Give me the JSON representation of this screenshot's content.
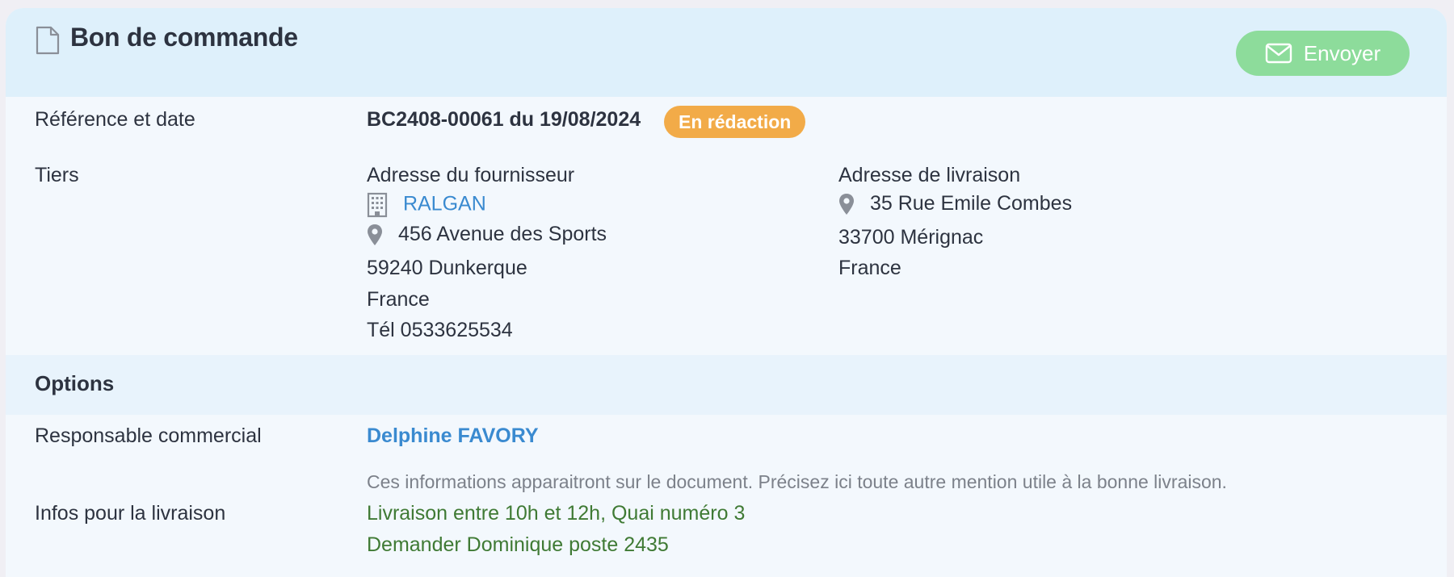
{
  "header": {
    "title": "Bon de commande",
    "send_label": "Envoyer"
  },
  "reference": {
    "label": "Référence et date",
    "value": "BC2408-00061 du 19/08/2024",
    "status": "En rédaction"
  },
  "tiers": {
    "label": "Tiers",
    "supplier": {
      "heading": "Adresse du fournisseur",
      "name": "RALGAN",
      "street": "456 Avenue des Sports",
      "city": "59240 Dunkerque",
      "country": "France",
      "phone": "Tél 0533625534"
    },
    "delivery": {
      "heading": "Adresse de livraison",
      "street": "35 Rue Emile Combes",
      "city": "33700 Mérignac",
      "country": "France"
    }
  },
  "options": {
    "title": "Options",
    "sales_label": "Responsable commercial",
    "sales_value": "Delphine FAVORY",
    "delivery_info_label": "Infos pour la livraison",
    "delivery_info_hint": "Ces informations apparaitront sur le document. Précisez ici toute autre mention utile à la bonne livraison.",
    "delivery_info_lines": [
      "Livraison entre 10h et 12h, Quai numéro 3",
      "Demander Dominique poste 2435"
    ]
  },
  "colors": {
    "header_bg": "#def0fb",
    "send_button": "#8ddc9b",
    "status_badge": "#f2ab48",
    "link": "#3a8ad0",
    "delivery_text": "#3f7a34"
  },
  "icons": [
    "document-icon",
    "envelope-icon",
    "building-icon",
    "map-pin-icon"
  ]
}
